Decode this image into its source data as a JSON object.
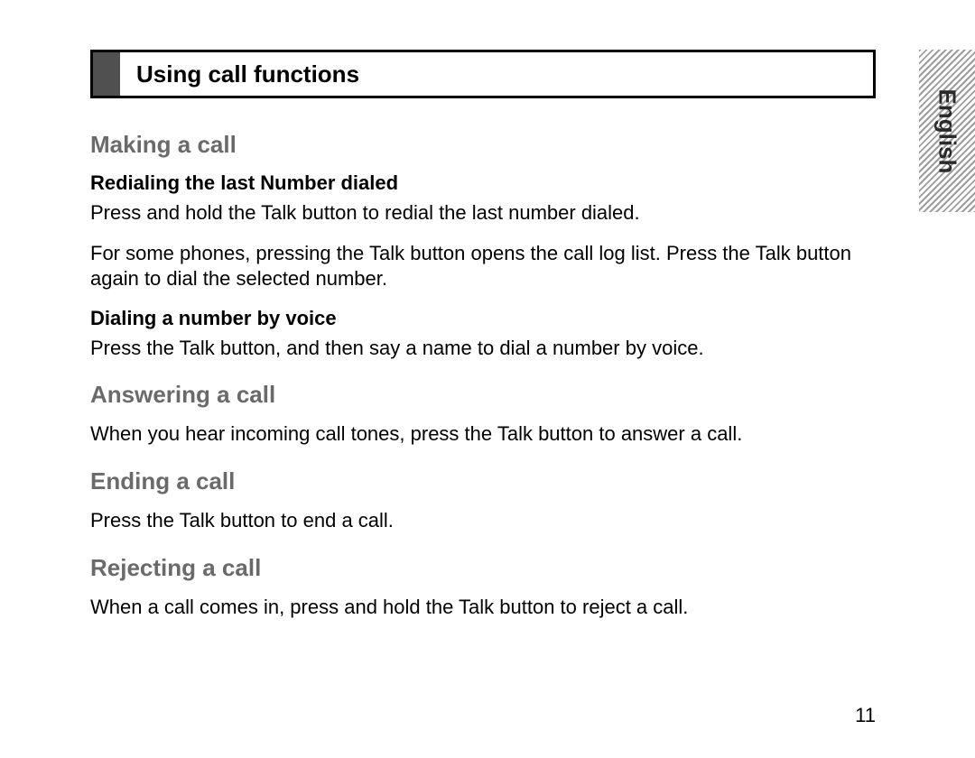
{
  "title": "Using call functions",
  "language_tab": "English",
  "page_number": "11",
  "sections": [
    {
      "heading": "Making a call",
      "subs": [
        {
          "sub_heading": "Redialing the last Number dialed",
          "paragraphs": [
            "Press and hold the Talk button to redial the last number dialed.",
            "For some phones, pressing the Talk button opens the call log list. Press the Talk button again to dial the selected number."
          ]
        },
        {
          "sub_heading": "Dialing a number by voice",
          "paragraphs": [
            "Press the Talk button, and then say a name to dial a number by voice."
          ]
        }
      ]
    },
    {
      "heading": "Answering a call",
      "paragraphs": [
        "When you hear incoming call tones, press the Talk button to answer a call."
      ]
    },
    {
      "heading": "Ending a call",
      "paragraphs": [
        "Press the Talk button to end a call."
      ]
    },
    {
      "heading": "Rejecting a call",
      "paragraphs": [
        "When a call comes in, press and hold the Talk button to reject a call."
      ]
    }
  ]
}
